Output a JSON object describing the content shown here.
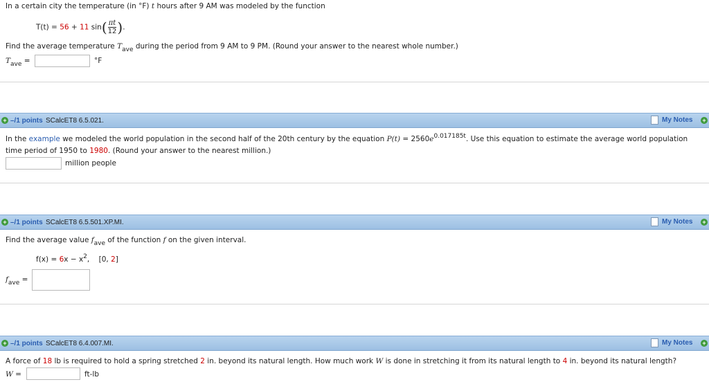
{
  "q1": {
    "intro_a": "In a certain city the temperature (in °F) ",
    "intro_var": "t",
    "intro_b": " hours after 9 AM was modeled by the function",
    "func_lhs": "T(t) = ",
    "func_c1": "56",
    "func_plus": " + ",
    "func_c2": "11",
    "func_sin": " sin",
    "frac_num": "πt",
    "frac_den": "12",
    "func_end": ".",
    "task_a": "Find the average temperature ",
    "task_var": "T",
    "task_sub": "ave",
    "task_b": " during the period from 9 AM to 9 PM. (Round your answer to the nearest whole number.)",
    "ans_var": "T",
    "ans_sub": "ave",
    "ans_eq": " =",
    "ans_value": "",
    "ans_unit": "°F"
  },
  "q2": {
    "header": {
      "points": "–/1 points",
      "code": "SCalcET8 6.5.021.",
      "notes": "My Notes"
    },
    "text_a": "In the ",
    "link": "example",
    "text_b": " we modeled the world population in the second half of the 20th century by the equation ",
    "eq_var": "P(t)",
    "eq_mid": " = 2560",
    "eq_e": "e",
    "eq_exp": "0.017185t",
    "text_c": ". Use this equation to estimate the average world population",
    "text_d": "time period of 1950 to ",
    "year": "1980",
    "text_e": ". (Round your answer to the nearest million.)",
    "ans_value": "",
    "ans_unit": "million people"
  },
  "q3": {
    "header": {
      "points": "–/1 points",
      "code": "SCalcET8 6.5.501.XP.MI.",
      "notes": "My Notes"
    },
    "text_a": "Find the average value ",
    "f_var": "f",
    "f_sub": "ave",
    "text_b": " of the function ",
    "f2": "f",
    "text_c": " on the given interval.",
    "func_lhs": "f(x) = ",
    "func_c1": "6",
    "func_mid": "x − x",
    "func_exp": "2",
    "func_comma": ",",
    "int_open": "[0, ",
    "int_val": "2",
    "int_close": "]",
    "ans_var": "f",
    "ans_sub": "ave",
    "ans_eq": " =",
    "ans_value": ""
  },
  "q4": {
    "header": {
      "points": "–/1 points",
      "code": "SCalcET8 6.4.007.MI.",
      "notes": "My Notes"
    },
    "text_a": "A force of ",
    "force": "18",
    "text_b": " lb is required to hold a spring stretched ",
    "stretch1": "2",
    "text_c": " in. beyond its natural length. How much work ",
    "w_var": "W",
    "text_d": " is done in stretching it from its natural length to ",
    "stretch2": "4",
    "text_e": " in. beyond its natural length?",
    "ans_var": "W",
    "ans_eq": " =",
    "ans_value": "",
    "ans_unit": "ft-lb"
  }
}
